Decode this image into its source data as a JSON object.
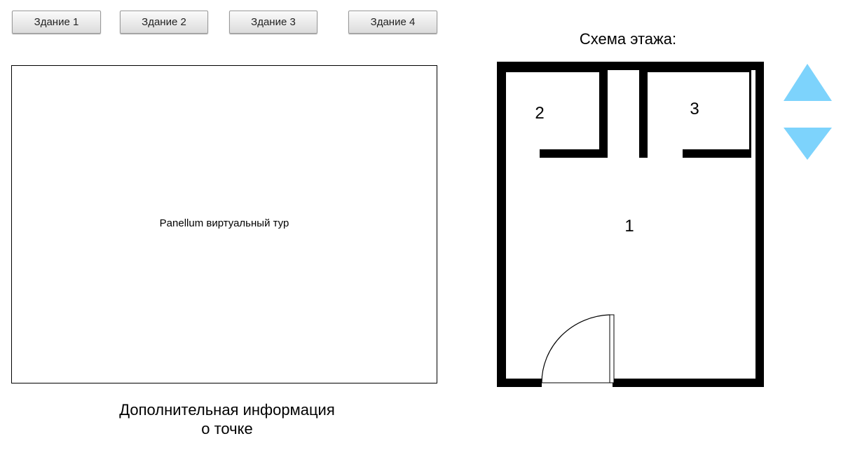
{
  "buildings": [
    {
      "label": "Здание 1"
    },
    {
      "label": "Здание 2"
    },
    {
      "label": "Здание 3"
    },
    {
      "label": "Здание 4"
    }
  ],
  "viewer": {
    "label": "Panellum виртуальный тур"
  },
  "info": {
    "line1": "Дополнительная информация",
    "line2": "о точке"
  },
  "floor_plan": {
    "title": "Схема этажа:",
    "rooms": [
      {
        "label": "1"
      },
      {
        "label": "2"
      },
      {
        "label": "3"
      }
    ],
    "floor_up_icon": "triangle-up",
    "floor_down_icon": "triangle-down",
    "arrow_color": "#7DD3FC"
  }
}
